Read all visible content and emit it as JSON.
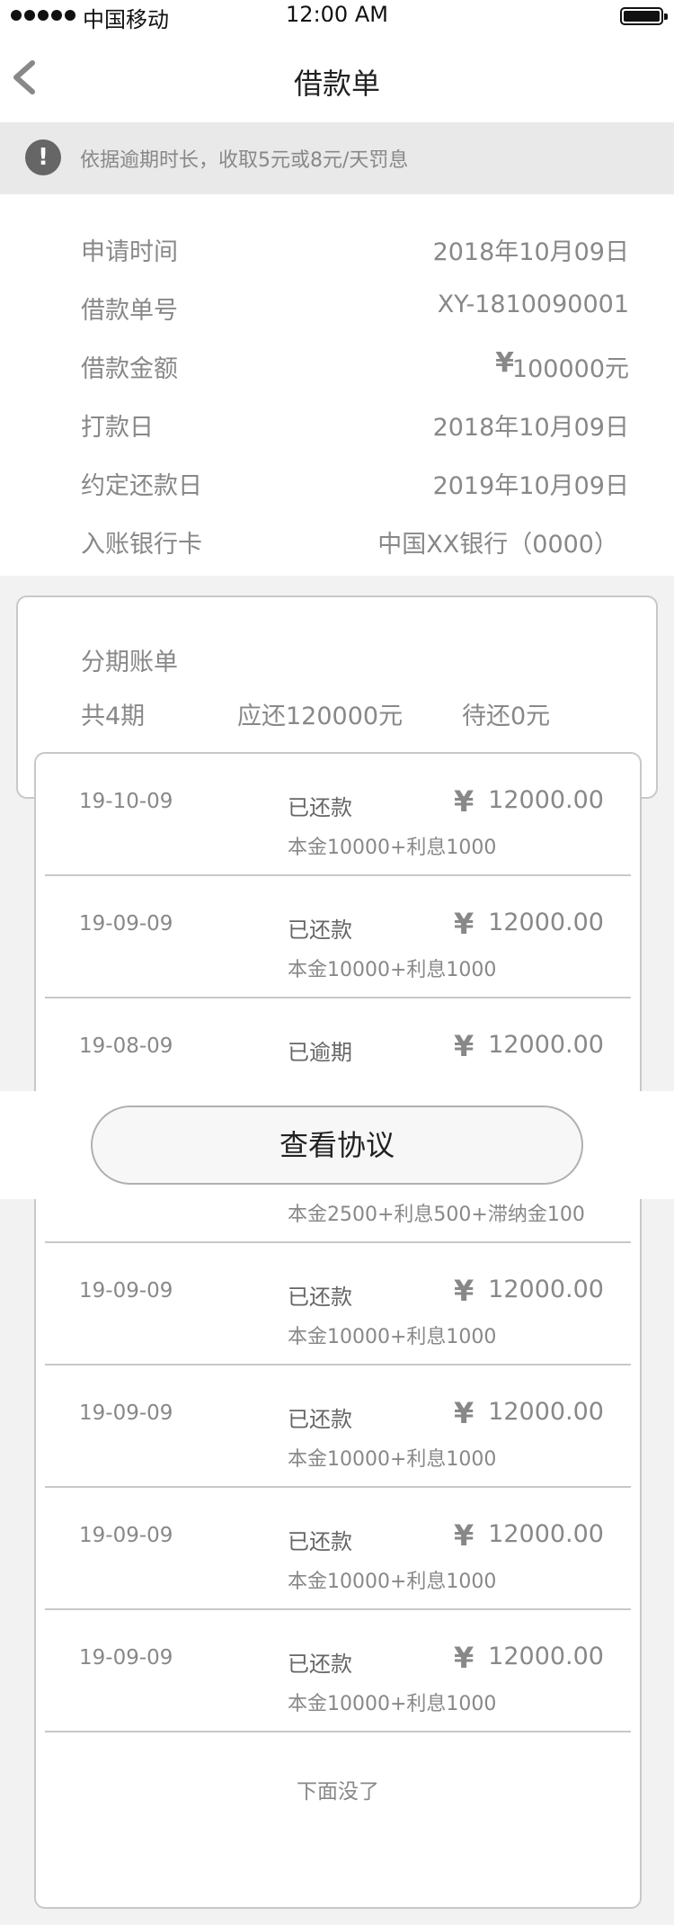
{
  "status_bar": {
    "carrier": "中国移动",
    "time": "12:00 AM"
  },
  "nav": {
    "title": "借款单",
    "back_icon": "chevron-left-icon"
  },
  "notice": {
    "icon": "exclamation-icon",
    "icon_glyph": "!",
    "text": "依据逾期时长，收取5元或8元/天罚息"
  },
  "info": {
    "rows": [
      {
        "label": "申请时间",
        "value": "2018年10月09日"
      },
      {
        "label": "借款单号",
        "value": "XY-1810090001"
      },
      {
        "label": "借款金额",
        "currency": "¥",
        "value": "100000元"
      },
      {
        "label": "打款日",
        "value": "2018年10月09日"
      },
      {
        "label": "约定还款日",
        "value": "2019年10月09日"
      },
      {
        "label": "入账银行卡",
        "value": "中国XX银行（0000）"
      }
    ]
  },
  "plan": {
    "title": "分期账单",
    "total_periods": "共4期",
    "due": "应还120000元",
    "pending": "待还0元"
  },
  "bills": [
    {
      "date": "19-10-09",
      "status": "已还款",
      "currency": "¥",
      "amount": "12000.00",
      "detail": "本金10000+利息1000"
    },
    {
      "date": "19-09-09",
      "status": "已还款",
      "currency": "¥",
      "amount": "12000.00",
      "detail": "本金10000+利息1000"
    },
    {
      "date": "19-08-09",
      "status": "已逾期",
      "currency": "¥",
      "amount": "12000.00",
      "detail": ""
    },
    {
      "date": "",
      "status": "",
      "currency": "",
      "amount": "",
      "detail": "本金2500+利息500+滞纳金100"
    },
    {
      "date": "19-09-09",
      "status": "已还款",
      "currency": "¥",
      "amount": "12000.00",
      "detail": "本金10000+利息1000"
    },
    {
      "date": "19-09-09",
      "status": "已还款",
      "currency": "¥",
      "amount": "12000.00",
      "detail": "本金10000+利息1000"
    },
    {
      "date": "19-09-09",
      "status": "已还款",
      "currency": "¥",
      "amount": "12000.00",
      "detail": "本金10000+利息1000"
    },
    {
      "date": "19-09-09",
      "status": "已还款",
      "currency": "¥",
      "amount": "12000.00",
      "detail": "本金10000+利息1000"
    }
  ],
  "list_end": "下面没了",
  "agreement": {
    "label": "查看协议"
  }
}
